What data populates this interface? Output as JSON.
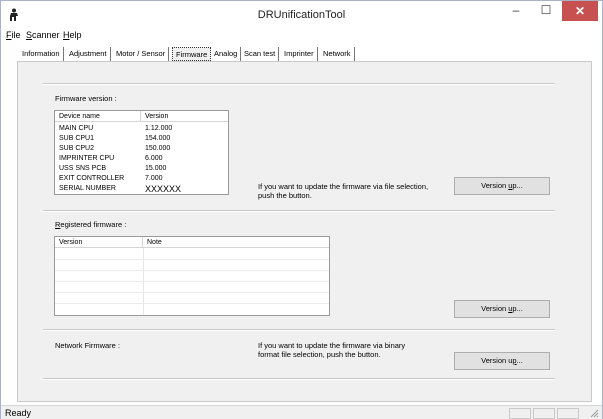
{
  "window": {
    "title": "DRUnificationTool",
    "minimize": "–",
    "maximize": "☐",
    "close": "✕"
  },
  "menu": [
    "File",
    "Scanner",
    "Help"
  ],
  "tabs": [
    "Information",
    "Adjustment",
    "Motor / Sensor",
    "Firmware",
    "Analog",
    "Scan test",
    "Imprinter",
    "Network"
  ],
  "active_tab": "Firmware",
  "firmware": {
    "label": "Firmware version :",
    "columns": [
      "Device name",
      "Version"
    ],
    "rows": [
      {
        "name": "MAIN CPU",
        "version": "1.12.000"
      },
      {
        "name": "SUB CPU1",
        "version": "154.000"
      },
      {
        "name": "SUB CPU2",
        "version": "150.000"
      },
      {
        "name": "IMPRINTER CPU",
        "version": "6.000"
      },
      {
        "name": "USS SNS PCB",
        "version": "15.000"
      },
      {
        "name": "EXIT CONTROLLER",
        "version": "7.000"
      },
      {
        "name": "SERIAL NUMBER",
        "version": "XXXXXX"
      }
    ],
    "hint_line1": "If you want to update the firmware via file selection,",
    "hint_line2": "push the button.",
    "button": {
      "pre": "Version ",
      "accel": "u",
      "post": "p..."
    }
  },
  "registered": {
    "label": "Registered firmware :",
    "columns": [
      "Version",
      "Note"
    ],
    "button": {
      "pre": "Version ",
      "accel": "u",
      "post": "p..."
    }
  },
  "network": {
    "label": "Network Firmware :",
    "hint_line1": "If you want to update the firmware via binary",
    "hint_line2": "format file selection, push the button.",
    "button": {
      "pre": "Version u",
      "accel": "p",
      "post": "..."
    }
  },
  "status": {
    "text": "Ready"
  }
}
